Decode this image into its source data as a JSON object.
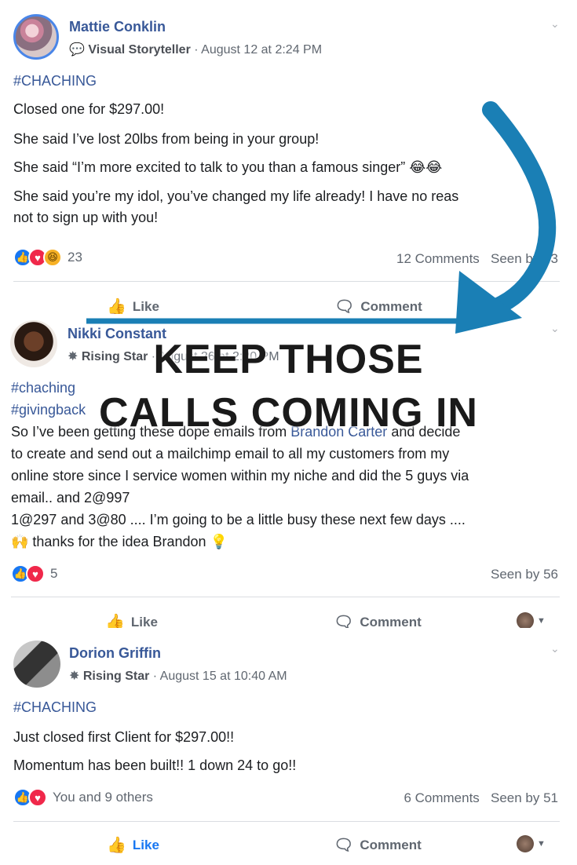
{
  "posts": [
    {
      "author": "Mattie Conklin",
      "badge": "Visual Storyteller",
      "time": "August 12 at 2:24 PM",
      "hashtags": [
        "#CHACHING"
      ],
      "lines": [
        "Closed one for $297.00!",
        "She said I’ve lost 20lbs from being in your group!",
        "She said “I’m more excited to talk to you than a famous singer” 😂😂",
        "She said you’re my idol, you’ve changed my life already! I have no reas",
        "not to sign up with you!"
      ],
      "reaction_count": "23",
      "comments": "12 Comments",
      "seen": "Seen by 93",
      "like_label": "Like",
      "comment_label": "Comment"
    },
    {
      "author": "Nikki Constant",
      "badge": "Rising Star",
      "time": "August 26 at 2:20 PM",
      "hashtags": [
        "#chaching",
        "#givingback"
      ],
      "lines": [
        "So I’ve been getting these dope emails from",
        "Brandon Carter",
        "and decide",
        "to create and send out a mailchimp email to all my customers from my",
        "online store since I service women within my niche and did the 5 guys via",
        "email.. and 2@997",
        "1@297 and 3@80 .... I’m going to be a little busy these next few days ....",
        "🙌 thanks for the idea Brandon 💡"
      ],
      "reaction_count": "5",
      "seen": "Seen by 56",
      "like_label": "Like",
      "comment_label": "Comment"
    },
    {
      "author": "Dorion Griffin",
      "badge": "Rising Star",
      "time": "August 15 at 10:40 AM",
      "hashtags": [
        "#CHACHING"
      ],
      "lines": [
        "Just closed first Client for $297.00!!",
        "Momentum has been built!! 1 down 24 to go!!"
      ],
      "reaction_text": "You and 9 others",
      "comments": "6 Comments",
      "seen": "Seen by 51",
      "like_label": "Like",
      "comment_label": "Comment"
    }
  ],
  "overlay": {
    "line1": "KEEP THOSE",
    "line2": "CALLS COMING IN",
    "arrow_color": "#1a7fb5"
  }
}
